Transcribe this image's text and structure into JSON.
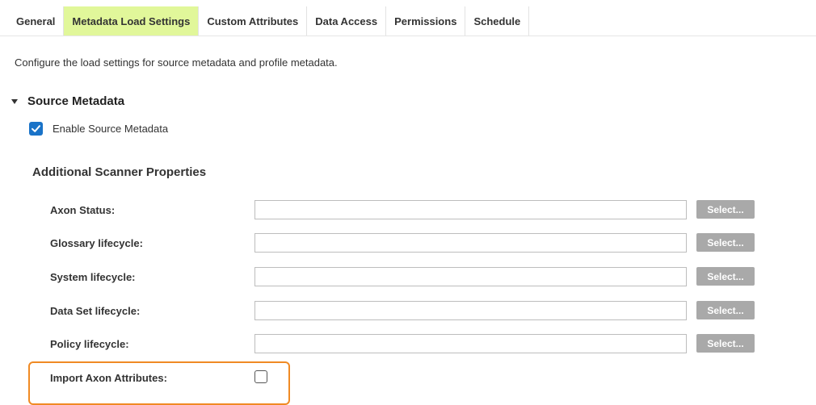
{
  "tabs": [
    {
      "label": "General",
      "active": false
    },
    {
      "label": "Metadata Load Settings",
      "active": true
    },
    {
      "label": "Custom Attributes",
      "active": false
    },
    {
      "label": "Data Access",
      "active": false
    },
    {
      "label": "Permissions",
      "active": false
    },
    {
      "label": "Schedule",
      "active": false
    }
  ],
  "description": "Configure the load settings for source metadata and profile metadata.",
  "section": {
    "title": "Source Metadata",
    "expanded": true,
    "enable_label": "Enable Source Metadata",
    "enable_checked": true
  },
  "scanner": {
    "heading": "Additional Scanner Properties",
    "properties": [
      {
        "label": "Axon Status:",
        "value": "",
        "button": "Select..."
      },
      {
        "label": "Glossary lifecycle:",
        "value": "",
        "button": "Select..."
      },
      {
        "label": "System lifecycle:",
        "value": "",
        "button": "Select..."
      },
      {
        "label": "Data Set lifecycle:",
        "value": "",
        "button": "Select..."
      },
      {
        "label": "Policy lifecycle:",
        "value": "",
        "button": "Select..."
      }
    ],
    "import_label": "Import Axon Attributes:",
    "import_checked": false
  },
  "colors": {
    "active_tab": "#e1f79a",
    "checkbox": "#1a73c8",
    "button": "#a9a9a9",
    "highlight": "#f08a24"
  }
}
